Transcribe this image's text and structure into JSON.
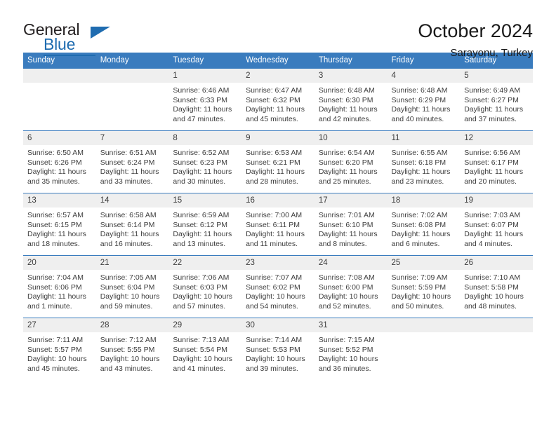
{
  "logo": {
    "word_top": "General",
    "word_bottom": "Blue",
    "accent_color": "#1f6cb0"
  },
  "header": {
    "title": "October 2024",
    "subtitle": "Sarayonu, Turkey",
    "header_bg": "#3a7cbe",
    "daynum_bg": "#efefef"
  },
  "weekdays": [
    "Sunday",
    "Monday",
    "Tuesday",
    "Wednesday",
    "Thursday",
    "Friday",
    "Saturday"
  ],
  "labels": {
    "sunrise": "Sunrise:",
    "sunset": "Sunset:",
    "daylight": "Daylight:"
  },
  "weeks": [
    [
      {
        "day": "",
        "blank": true
      },
      {
        "day": "",
        "blank": true
      },
      {
        "day": "1",
        "sunrise": "Sunrise: 6:46 AM",
        "sunset": "Sunset: 6:33 PM",
        "daylight1": "Daylight: 11 hours",
        "daylight2": "and 47 minutes."
      },
      {
        "day": "2",
        "sunrise": "Sunrise: 6:47 AM",
        "sunset": "Sunset: 6:32 PM",
        "daylight1": "Daylight: 11 hours",
        "daylight2": "and 45 minutes."
      },
      {
        "day": "3",
        "sunrise": "Sunrise: 6:48 AM",
        "sunset": "Sunset: 6:30 PM",
        "daylight1": "Daylight: 11 hours",
        "daylight2": "and 42 minutes."
      },
      {
        "day": "4",
        "sunrise": "Sunrise: 6:48 AM",
        "sunset": "Sunset: 6:29 PM",
        "daylight1": "Daylight: 11 hours",
        "daylight2": "and 40 minutes."
      },
      {
        "day": "5",
        "sunrise": "Sunrise: 6:49 AM",
        "sunset": "Sunset: 6:27 PM",
        "daylight1": "Daylight: 11 hours",
        "daylight2": "and 37 minutes."
      }
    ],
    [
      {
        "day": "6",
        "sunrise": "Sunrise: 6:50 AM",
        "sunset": "Sunset: 6:26 PM",
        "daylight1": "Daylight: 11 hours",
        "daylight2": "and 35 minutes."
      },
      {
        "day": "7",
        "sunrise": "Sunrise: 6:51 AM",
        "sunset": "Sunset: 6:24 PM",
        "daylight1": "Daylight: 11 hours",
        "daylight2": "and 33 minutes."
      },
      {
        "day": "8",
        "sunrise": "Sunrise: 6:52 AM",
        "sunset": "Sunset: 6:23 PM",
        "daylight1": "Daylight: 11 hours",
        "daylight2": "and 30 minutes."
      },
      {
        "day": "9",
        "sunrise": "Sunrise: 6:53 AM",
        "sunset": "Sunset: 6:21 PM",
        "daylight1": "Daylight: 11 hours",
        "daylight2": "and 28 minutes."
      },
      {
        "day": "10",
        "sunrise": "Sunrise: 6:54 AM",
        "sunset": "Sunset: 6:20 PM",
        "daylight1": "Daylight: 11 hours",
        "daylight2": "and 25 minutes."
      },
      {
        "day": "11",
        "sunrise": "Sunrise: 6:55 AM",
        "sunset": "Sunset: 6:18 PM",
        "daylight1": "Daylight: 11 hours",
        "daylight2": "and 23 minutes."
      },
      {
        "day": "12",
        "sunrise": "Sunrise: 6:56 AM",
        "sunset": "Sunset: 6:17 PM",
        "daylight1": "Daylight: 11 hours",
        "daylight2": "and 20 minutes."
      }
    ],
    [
      {
        "day": "13",
        "sunrise": "Sunrise: 6:57 AM",
        "sunset": "Sunset: 6:15 PM",
        "daylight1": "Daylight: 11 hours",
        "daylight2": "and 18 minutes."
      },
      {
        "day": "14",
        "sunrise": "Sunrise: 6:58 AM",
        "sunset": "Sunset: 6:14 PM",
        "daylight1": "Daylight: 11 hours",
        "daylight2": "and 16 minutes."
      },
      {
        "day": "15",
        "sunrise": "Sunrise: 6:59 AM",
        "sunset": "Sunset: 6:12 PM",
        "daylight1": "Daylight: 11 hours",
        "daylight2": "and 13 minutes."
      },
      {
        "day": "16",
        "sunrise": "Sunrise: 7:00 AM",
        "sunset": "Sunset: 6:11 PM",
        "daylight1": "Daylight: 11 hours",
        "daylight2": "and 11 minutes."
      },
      {
        "day": "17",
        "sunrise": "Sunrise: 7:01 AM",
        "sunset": "Sunset: 6:10 PM",
        "daylight1": "Daylight: 11 hours",
        "daylight2": "and 8 minutes."
      },
      {
        "day": "18",
        "sunrise": "Sunrise: 7:02 AM",
        "sunset": "Sunset: 6:08 PM",
        "daylight1": "Daylight: 11 hours",
        "daylight2": "and 6 minutes."
      },
      {
        "day": "19",
        "sunrise": "Sunrise: 7:03 AM",
        "sunset": "Sunset: 6:07 PM",
        "daylight1": "Daylight: 11 hours",
        "daylight2": "and 4 minutes."
      }
    ],
    [
      {
        "day": "20",
        "sunrise": "Sunrise: 7:04 AM",
        "sunset": "Sunset: 6:06 PM",
        "daylight1": "Daylight: 11 hours",
        "daylight2": "and 1 minute."
      },
      {
        "day": "21",
        "sunrise": "Sunrise: 7:05 AM",
        "sunset": "Sunset: 6:04 PM",
        "daylight1": "Daylight: 10 hours",
        "daylight2": "and 59 minutes."
      },
      {
        "day": "22",
        "sunrise": "Sunrise: 7:06 AM",
        "sunset": "Sunset: 6:03 PM",
        "daylight1": "Daylight: 10 hours",
        "daylight2": "and 57 minutes."
      },
      {
        "day": "23",
        "sunrise": "Sunrise: 7:07 AM",
        "sunset": "Sunset: 6:02 PM",
        "daylight1": "Daylight: 10 hours",
        "daylight2": "and 54 minutes."
      },
      {
        "day": "24",
        "sunrise": "Sunrise: 7:08 AM",
        "sunset": "Sunset: 6:00 PM",
        "daylight1": "Daylight: 10 hours",
        "daylight2": "and 52 minutes."
      },
      {
        "day": "25",
        "sunrise": "Sunrise: 7:09 AM",
        "sunset": "Sunset: 5:59 PM",
        "daylight1": "Daylight: 10 hours",
        "daylight2": "and 50 minutes."
      },
      {
        "day": "26",
        "sunrise": "Sunrise: 7:10 AM",
        "sunset": "Sunset: 5:58 PM",
        "daylight1": "Daylight: 10 hours",
        "daylight2": "and 48 minutes."
      }
    ],
    [
      {
        "day": "27",
        "sunrise": "Sunrise: 7:11 AM",
        "sunset": "Sunset: 5:57 PM",
        "daylight1": "Daylight: 10 hours",
        "daylight2": "and 45 minutes."
      },
      {
        "day": "28",
        "sunrise": "Sunrise: 7:12 AM",
        "sunset": "Sunset: 5:55 PM",
        "daylight1": "Daylight: 10 hours",
        "daylight2": "and 43 minutes."
      },
      {
        "day": "29",
        "sunrise": "Sunrise: 7:13 AM",
        "sunset": "Sunset: 5:54 PM",
        "daylight1": "Daylight: 10 hours",
        "daylight2": "and 41 minutes."
      },
      {
        "day": "30",
        "sunrise": "Sunrise: 7:14 AM",
        "sunset": "Sunset: 5:53 PM",
        "daylight1": "Daylight: 10 hours",
        "daylight2": "and 39 minutes."
      },
      {
        "day": "31",
        "sunrise": "Sunrise: 7:15 AM",
        "sunset": "Sunset: 5:52 PM",
        "daylight1": "Daylight: 10 hours",
        "daylight2": "and 36 minutes."
      },
      {
        "day": "",
        "blank": true
      },
      {
        "day": "",
        "blank": true
      }
    ]
  ]
}
